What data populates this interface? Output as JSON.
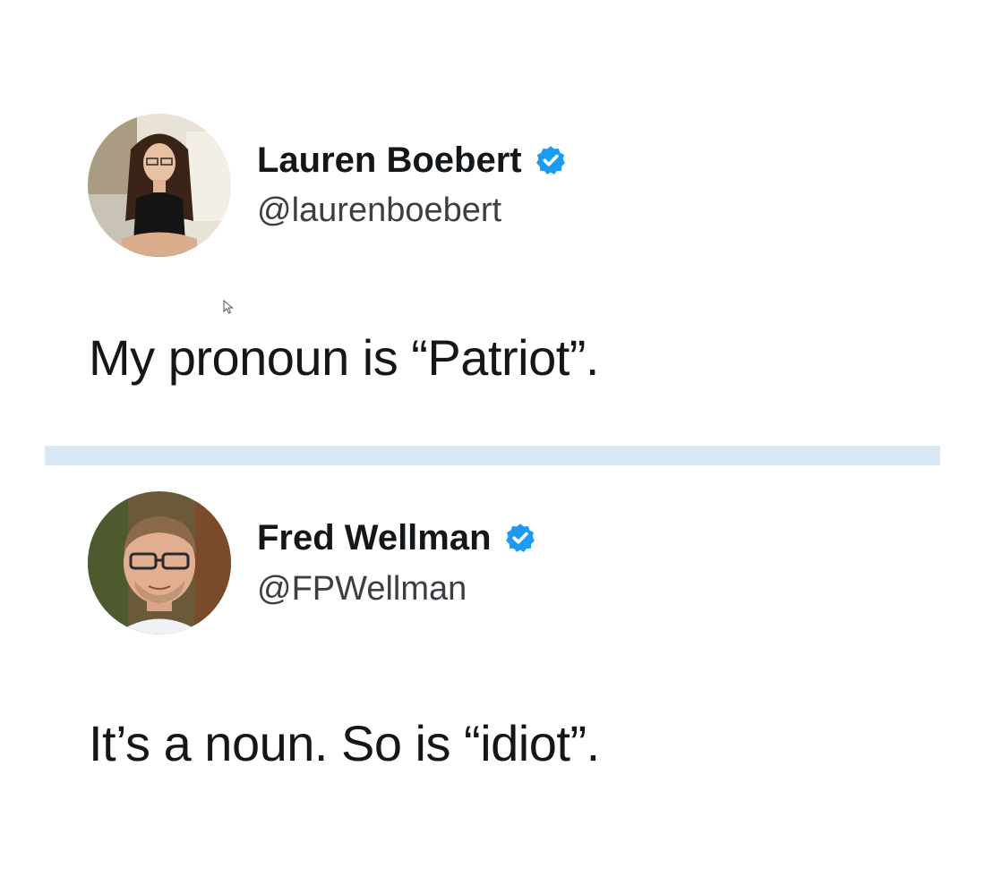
{
  "tweets": [
    {
      "display_name": "Lauren Boebert",
      "handle": "@laurenboebert",
      "text": "My pronoun is “Patriot”.",
      "verified": true,
      "avatar_icon": "avatar-photo-woman"
    },
    {
      "display_name": "Fred Wellman",
      "handle": "@FPWellman",
      "text": "It’s a noun. So is “idiot”.",
      "verified": true,
      "avatar_icon": "avatar-photo-man-glasses"
    }
  ],
  "icons": {
    "verified": "verified-badge-icon",
    "cursor": "mouse-cursor-icon"
  },
  "colors": {
    "verified_blue": "#1d9bf0",
    "text": "#14171a",
    "handle": "#3b3f44",
    "divider": "#d8e8f5",
    "background": "#ffffff"
  }
}
